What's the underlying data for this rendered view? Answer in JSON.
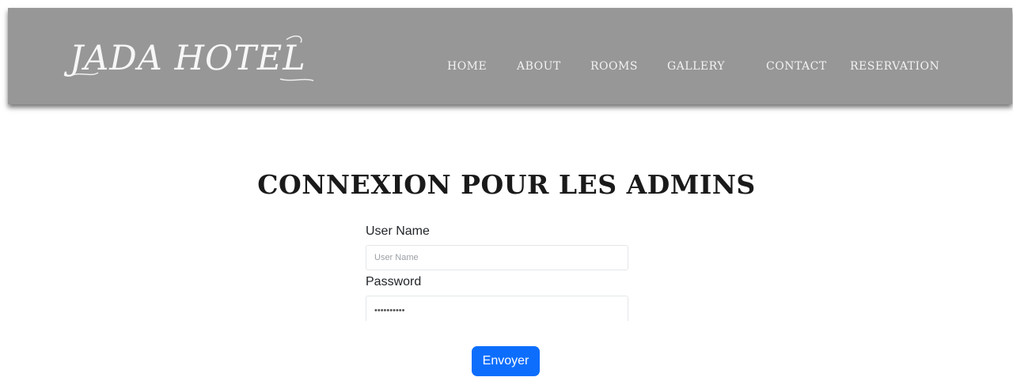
{
  "header": {
    "brand": "JADA HOTEL",
    "nav": [
      {
        "label": "HOME"
      },
      {
        "label": "ABOUT"
      },
      {
        "label": "ROOMS"
      },
      {
        "label": "GALLERY"
      },
      {
        "label": "CONTACT"
      },
      {
        "label": "RESERVATION"
      }
    ]
  },
  "main": {
    "title": "CONNEXION POUR LES ADMINS",
    "form": {
      "username_label": "User Name",
      "username_placeholder": "User Name",
      "username_value": "",
      "password_label": "Password",
      "password_value": "••••••••••",
      "submit_label": "Envoyer"
    }
  },
  "colors": {
    "navbar_bg": "#979797",
    "button_bg": "#0d6efd",
    "title_text": "#1a1a1a"
  }
}
